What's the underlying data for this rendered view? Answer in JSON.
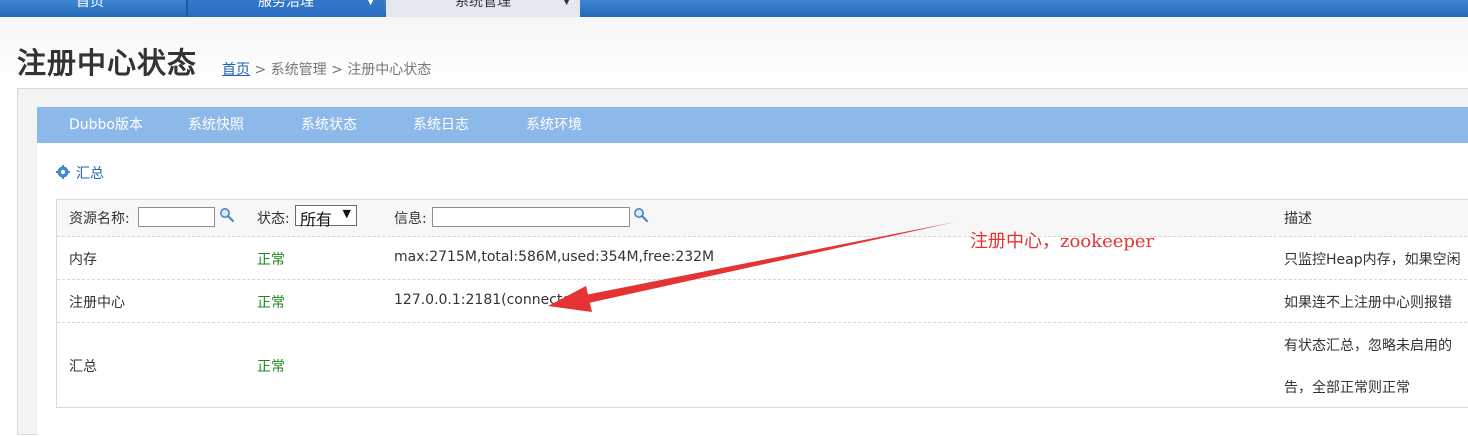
{
  "nav": {
    "items": [
      {
        "label": "首页"
      },
      {
        "label": "服务治理"
      },
      {
        "label": "系统管理"
      }
    ]
  },
  "header": {
    "title": "注册中心状态",
    "breadcrumb": {
      "home": "首页",
      "sep1": ">",
      "section": "系统管理",
      "sep2": ">",
      "current": "注册中心状态"
    }
  },
  "tabs": [
    {
      "label": "Dubbo版本"
    },
    {
      "label": "系统快照"
    },
    {
      "label": "系统状态"
    },
    {
      "label": "系统日志"
    },
    {
      "label": "系统环境"
    }
  ],
  "summary": {
    "label": "汇总"
  },
  "table": {
    "headers": {
      "resource": "资源名称:",
      "status": "状态:",
      "status_selected": "所有",
      "info": "信息:",
      "description": "描述"
    },
    "rows": [
      {
        "resource": "内存",
        "status": "正常",
        "info": "max:2715M,total:586M,used:354M,free:232M",
        "description": "只监控Heap内存，如果空闲"
      },
      {
        "resource": "注册中心",
        "status": "正常",
        "info": "127.0.0.1:2181(connected)",
        "description": "如果连不上注册中心则报错"
      },
      {
        "resource": "汇总",
        "status": "正常",
        "info": "",
        "description": "有状态汇总，忽略未启用的",
        "description_line2": "告，全部正常则正常"
      }
    ]
  },
  "annotation": {
    "text": "注册中心，zookeeper",
    "color": "#e53333"
  },
  "colors": {
    "nav": "#2468b8",
    "tabbar": "#8db9ea",
    "ok": "#1b8a1b",
    "link": "#1f63b3"
  }
}
